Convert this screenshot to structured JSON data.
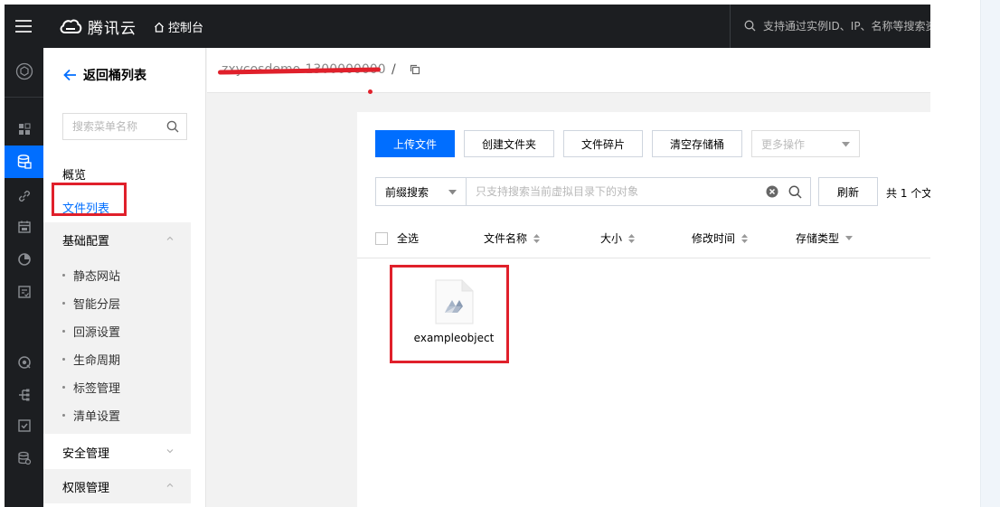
{
  "topbar": {
    "logo_text": "腾讯云",
    "console_label": "控制台",
    "search_placeholder": "支持通过实例ID、IP、名称等搜索资"
  },
  "rail": {
    "icons": [
      "cube-icon",
      "grid-icon",
      "storage-icon",
      "link-icon",
      "calendar-icon",
      "pie-chart-icon",
      "document-check-icon",
      "eye-icon",
      "flow-icon",
      "check-box-icon",
      "database-icon"
    ],
    "active_index": 2
  },
  "sidebar": {
    "back_label": "返回桶列表",
    "search_placeholder": "搜索菜单名称",
    "items": [
      {
        "label": "概览"
      },
      {
        "label": "文件列表",
        "active": true
      }
    ],
    "groups": [
      {
        "label": "基础配置",
        "expanded": true,
        "children": [
          "静态网站",
          "智能分层",
          "回源设置",
          "生命周期",
          "标签管理",
          "清单设置"
        ]
      },
      {
        "label": "安全管理",
        "expanded": false
      },
      {
        "label": "权限管理",
        "expanded": true
      }
    ]
  },
  "breadcrumb": {
    "bucket_name": "zxycosdemo-1300000000",
    "separator": "/"
  },
  "toolbar": {
    "upload": "上传文件",
    "create_folder": "创建文件夹",
    "fragments": "文件碎片",
    "clear_bucket": "清空存储桶",
    "more": "更多操作"
  },
  "filter": {
    "prefix_option": "前缀搜索",
    "query_placeholder": "只支持搜索当前虚拟目录下的对象",
    "refresh": "刷新",
    "total_text": "共 1 个文"
  },
  "table": {
    "select_all": "全选",
    "columns": [
      "文件名称",
      "大小",
      "修改时间",
      "存储类型"
    ]
  },
  "files": [
    {
      "name": "exampleobject",
      "icon": "file-icon"
    }
  ],
  "colors": {
    "accent": "#006eff",
    "highlight": "#e0202b",
    "topbar": "#1c1e21"
  }
}
